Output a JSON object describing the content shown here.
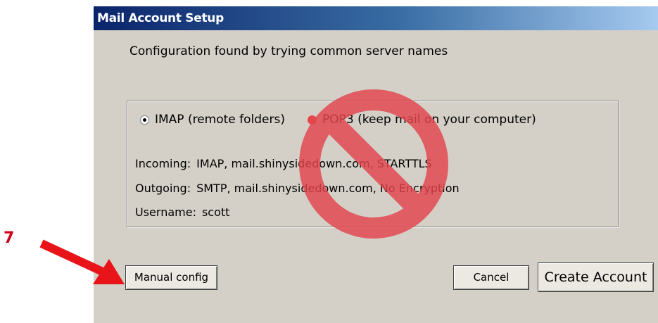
{
  "dialog": {
    "title": "Mail Account Setup",
    "config_message": "Configuration found by trying common server names",
    "protocol_options": [
      {
        "label": "IMAP (remote folders)",
        "selected": true
      },
      {
        "label": "POP3 (keep mail on your computer)",
        "selected": false
      }
    ],
    "server_info": {
      "incoming_label": "Incoming:",
      "incoming_value": "IMAP, mail.shinysidedown.com, STARTTLS",
      "outgoing_label": "Outgoing:",
      "outgoing_value": "SMTP, mail.shinysidedown.com, No Encryption",
      "username_label": "Username:",
      "username_value": "scott"
    },
    "buttons": {
      "manual_config": "Manual config",
      "cancel": "Cancel",
      "create_account": "Create Account"
    }
  },
  "annotation": {
    "step_number": "7",
    "arrow_color": "#e8141a",
    "prohibit_color": "#e3464d"
  },
  "icons": [
    "prohibit-icon",
    "arrow-icon",
    "radio-icon"
  ]
}
